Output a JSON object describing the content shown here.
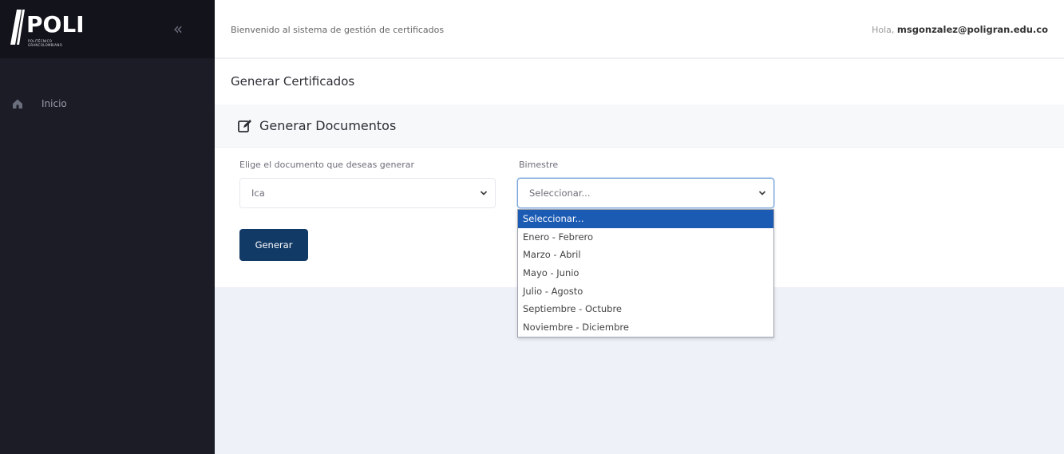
{
  "sidebar": {
    "logo_text": "POLI",
    "logo_subtitle_1": "POLITÉCNICO",
    "logo_subtitle_2": "GRANCOLOMBIANO",
    "collapse_glyph": "«",
    "items": [
      {
        "label": "Inicio",
        "icon": "home-icon"
      }
    ]
  },
  "header": {
    "welcome": "Bienvenido al sistema de gestión de certificados",
    "greeting_prefix": "Hola,",
    "user_email": "msgonzalez@poligran.edu.co"
  },
  "page": {
    "title": "Generar Certificados"
  },
  "card": {
    "title": "Generar Documentos",
    "icon": "edit-icon",
    "document_label": "Elige el documento que deseas generar",
    "document_value": "Ica",
    "period_label": "Bimestre",
    "period_value": "Seleccionar...",
    "generate_button": "Generar"
  },
  "dropdown": {
    "options": [
      "Seleccionar...",
      "Enero - Febrero",
      "Marzo - Abril",
      "Mayo - Junio",
      "Julio - Agosto",
      "Septiembre - Octubre",
      "Noviembre - Diciembre"
    ],
    "selected_index": 0
  },
  "colors": {
    "sidebar_bg": "#1b1c26",
    "primary_button": "#123a66",
    "selected_option": "#1c5bb4",
    "content_bg": "#eef1f7"
  }
}
